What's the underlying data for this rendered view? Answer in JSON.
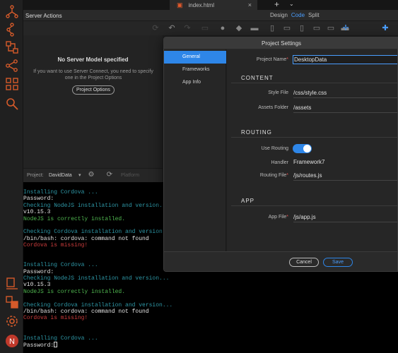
{
  "tabs": {
    "file_name": "index.html",
    "close": "×",
    "new_tab": "+",
    "more": "⌄"
  },
  "header": {
    "panel_title": "Server Actions",
    "views": [
      "Design",
      "Code",
      "Split"
    ],
    "active_view": "Code"
  },
  "server_panel": {
    "title": "No Server Model specified",
    "description": "If you want to use Server Connect, you need to specify one in the Project Options",
    "button": "Project Options"
  },
  "project_bar": {
    "label": "Project:",
    "value": "DavidData",
    "platform": "Platform"
  },
  "terminal": {
    "lines": [
      {
        "text": "Installing Cordova ...",
        "color": "cyan"
      },
      {
        "text": "Password:",
        "color": "white"
      },
      {
        "text": "Checking NodeJS installation and version...",
        "color": "cyan"
      },
      {
        "text": "v10.15.3",
        "color": "white"
      },
      {
        "text": "NodeJS is correctly installed.",
        "color": "green"
      },
      {
        "text": "",
        "color": "white"
      },
      {
        "text": "Checking Cordova installation and version...",
        "color": "cyan"
      },
      {
        "text": "/bin/bash: cordova: command not found",
        "color": "white"
      },
      {
        "text": "Cordova is missing!",
        "color": "red"
      },
      {
        "text": "",
        "color": "white"
      },
      {
        "text": "",
        "color": "white"
      },
      {
        "text": "Installing Cordova ...",
        "color": "cyan"
      },
      {
        "text": "Password:",
        "color": "white"
      },
      {
        "text": "Checking NodeJS installation and version...",
        "color": "cyan"
      },
      {
        "text": "v10.15.3",
        "color": "white"
      },
      {
        "text": "NodeJS is correctly installed.",
        "color": "green"
      },
      {
        "text": "",
        "color": "white"
      },
      {
        "text": "Checking Cordova installation and version...",
        "color": "cyan"
      },
      {
        "text": "/bin/bash: cordova: command not found",
        "color": "white"
      },
      {
        "text": "Cordova is missing!",
        "color": "red"
      },
      {
        "text": "",
        "color": "white"
      },
      {
        "text": "",
        "color": "white"
      },
      {
        "text": "Installing Cordova ...",
        "color": "cyan"
      }
    ],
    "prompt": "Password:"
  },
  "dialog": {
    "title": "Project Settings",
    "nav": [
      "General",
      "Frameworks",
      "App Info"
    ],
    "active_nav": "General",
    "project_name_label": "Project Name",
    "project_name_value": "DesktopData",
    "content_section": "CONTENT",
    "style_file_label": "Style File",
    "style_file_value": "/css/style.css",
    "assets_folder_label": "Assets Folder",
    "assets_folder_value": "/assets",
    "routing_section": "ROUTING",
    "use_routing_label": "Use Routing",
    "use_routing_on": true,
    "handler_label": "Handler",
    "handler_value": "Framework7",
    "routing_file_label": "Routing File",
    "routing_file_value": "/js/routes.js",
    "app_section": "APP",
    "app_file_label": "App File",
    "app_file_value": "/js/app.js",
    "cancel": "Cancel",
    "save": "Save",
    "required_mark": "*"
  },
  "notification_badge": "N",
  "colors": {
    "accent": "#2e86e8",
    "terminal_cyan": "#2e97a6",
    "terminal_green": "#4fb54f",
    "terminal_red": "#cf3d3d",
    "html_icon": "#e55a2b"
  }
}
